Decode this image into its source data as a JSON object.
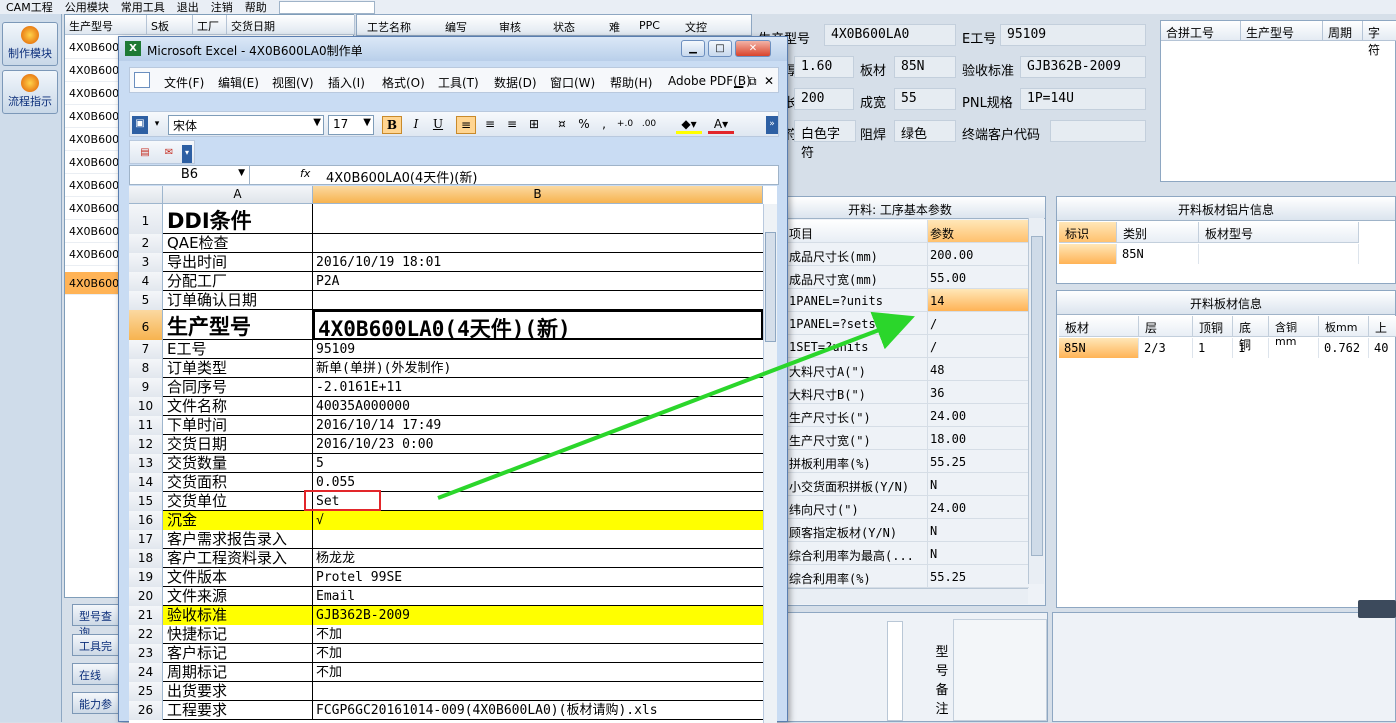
{
  "top_menu": {
    "items": [
      "CAM工程",
      "公用模块",
      "常用工具",
      "退出",
      "注销",
      "帮助"
    ]
  },
  "left_toolbar": {
    "items": [
      {
        "label": "制作模块"
      },
      {
        "label": "流程指示"
      }
    ]
  },
  "mid_list": {
    "headers": [
      "生产型号",
      "S板",
      "工厂",
      "交货日期"
    ],
    "rows": [
      "4X0B600",
      "4X0B600",
      "4X0B600",
      "4X0B600",
      "4X0B600",
      "4X0B600",
      "4X0B600",
      "4X0B600",
      "4X0B600",
      "4X0B600",
      "4X0B600",
      "4X0B600"
    ],
    "buttons": [
      "型号查询",
      "工具完",
      "在线",
      "能力参"
    ]
  },
  "process_header": [
    "工艺名称",
    "编写",
    "审核",
    "状态",
    "难",
    "PPC",
    "文控"
  ],
  "info": {
    "row1": {
      "model_label": "生产型号",
      "model": "4X0B600LA0",
      "eno_label": "E工号",
      "eno": "95109"
    },
    "row2": {
      "thick_label": "板厚",
      "thick": "1.60",
      "board_label": "板材",
      "board": "85N",
      "std_label": "验收标准",
      "std": "GJB362B-2009"
    },
    "row3": {
      "len_label": "成长",
      "len": "200",
      "wid_label": "成宽",
      "wid": "55",
      "pnl_label": "PNL规格",
      "pnl": "1P=14U"
    },
    "row4": {
      "char_label": "字符",
      "char": "白色字符",
      "mask_label": "阻焊",
      "mask": "绿色",
      "cust_label": "终端客户代码",
      "cust": ""
    }
  },
  "merge_grid": {
    "headers": [
      "合拼工号",
      "生产型号",
      "周期",
      "字符"
    ]
  },
  "param": {
    "title": "开料: 工序基本参数",
    "headers": [
      "项目",
      "参数"
    ],
    "rows": [
      {
        "item": "成品尺寸长(mm)",
        "value": "200.00"
      },
      {
        "item": "成品尺寸宽(mm)",
        "value": "55.00"
      },
      {
        "item": "1PANEL=?units",
        "value": "14"
      },
      {
        "item": "1PANEL=?sets",
        "value": "/"
      },
      {
        "item": "1SET=?units",
        "value": "/"
      },
      {
        "item": "大料尺寸A(\")",
        "value": "48"
      },
      {
        "item": "大料尺寸B(\")",
        "value": "36"
      },
      {
        "item": "生产尺寸长(\")",
        "value": "24.00"
      },
      {
        "item": "生产尺寸宽(\")",
        "value": "18.00"
      },
      {
        "item": "拼板利用率(%)",
        "value": "55.25"
      },
      {
        "item": "小交货面积拼板(Y/N)",
        "value": "N"
      },
      {
        "item": "纬向尺寸(\")",
        "value": "24.00"
      },
      {
        "item": "顾客指定板材(Y/N)",
        "value": "N"
      },
      {
        "item": "综合利用率为最高(...",
        "value": "N"
      },
      {
        "item": "综合利用率(%)",
        "value": "55.25"
      }
    ]
  },
  "sheet_info": {
    "title": "开料板材铝片信息",
    "headers": [
      "标识",
      "类别",
      "板材型号"
    ],
    "row": [
      "",
      "85N",
      ""
    ]
  },
  "board_info": {
    "title": "开料板材信息",
    "headers": [
      "板材",
      "层",
      "顶铜",
      "底铜",
      "含铜mm",
      "板mm",
      "上"
    ],
    "row": [
      "85N",
      "2/3",
      "1",
      "1",
      "",
      "0.762",
      "40"
    ]
  },
  "bottom": {
    "note_label": "型号备注"
  },
  "excel": {
    "title": "Microsoft Excel - 4X0B600LA0制作单",
    "menu": [
      "文件(F)",
      "编辑(E)",
      "视图(V)",
      "插入(I)",
      "格式(O)",
      "工具(T)",
      "数据(D)",
      "窗口(W)",
      "帮助(H)",
      "Adobe PDF(B)"
    ],
    "font_name": "宋体",
    "font_size": "17",
    "name_box": "B6",
    "fx": "fx",
    "formula": "4X0B600LA0(4天件)(新)",
    "col_a": "A",
    "col_b": "B",
    "rows": [
      {
        "n": "1",
        "a": "DDI条件",
        "b": ""
      },
      {
        "n": "2",
        "a": "QAE检查",
        "b": ""
      },
      {
        "n": "3",
        "a": "导出时间",
        "b": "2016/10/19 18:01"
      },
      {
        "n": "4",
        "a": "分配工厂",
        "b": "P2A"
      },
      {
        "n": "5",
        "a": "订单确认日期",
        "b": ""
      },
      {
        "n": "6",
        "a": "生产型号",
        "b": "4X0B600LA0(4天件)(新)"
      },
      {
        "n": "7",
        "a": "E工号",
        "b": "95109"
      },
      {
        "n": "8",
        "a": "订单类型",
        "b": "新单(单拼)(外发制作)"
      },
      {
        "n": "9",
        "a": "合同序号",
        "b": "-2.0161E+11"
      },
      {
        "n": "10",
        "a": "文件名称",
        "b": "40035A000000"
      },
      {
        "n": "11",
        "a": "下单时间",
        "b": "2016/10/14 17:49"
      },
      {
        "n": "12",
        "a": "交货日期",
        "b": "2016/10/23 0:00"
      },
      {
        "n": "13",
        "a": "交货数量",
        "b": "5"
      },
      {
        "n": "14",
        "a": "交货面积",
        "b": "0.055"
      },
      {
        "n": "15",
        "a": "交货单位",
        "b": "Set"
      },
      {
        "n": "16",
        "a": "沉金",
        "b": "√"
      },
      {
        "n": "17",
        "a": "客户需求报告录入",
        "b": ""
      },
      {
        "n": "18",
        "a": "客户工程资料录入",
        "b": "杨龙龙"
      },
      {
        "n": "19",
        "a": "文件版本",
        "b": "Protel 99SE"
      },
      {
        "n": "20",
        "a": "文件来源",
        "b": "Email"
      },
      {
        "n": "21",
        "a": "验收标准",
        "b": "GJB362B-2009"
      },
      {
        "n": "22",
        "a": "快捷标记",
        "b": "不加"
      },
      {
        "n": "23",
        "a": "客户标记",
        "b": "不加"
      },
      {
        "n": "24",
        "a": "周期标记",
        "b": "不加"
      },
      {
        "n": "25",
        "a": "出货要求",
        "b": ""
      },
      {
        "n": "26",
        "a": "工程要求",
        "b": "FCGP6GC20161014-009(4X0B600LA0)(板材请购).xls"
      }
    ]
  },
  "colors": {
    "highlight": "#ffff00",
    "selected": "#ffb356",
    "annotation_box": "#e2262a",
    "arrow": "#2bd62b"
  }
}
